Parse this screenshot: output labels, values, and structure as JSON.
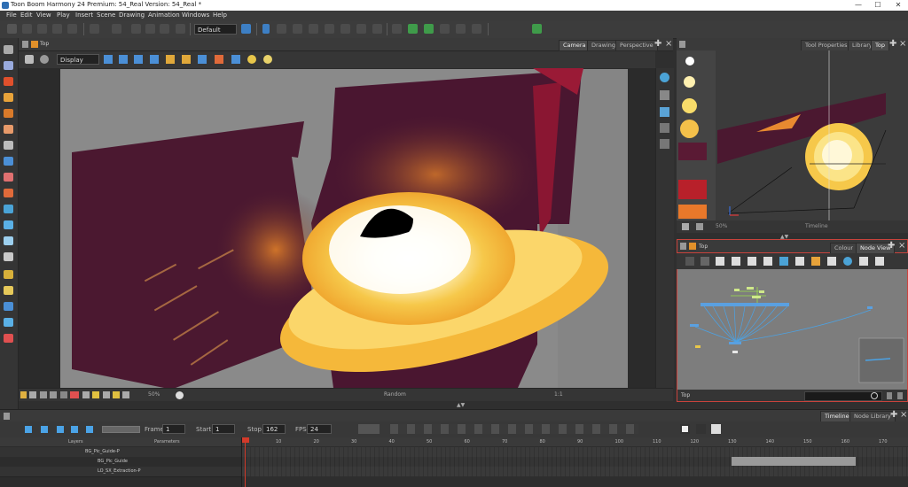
{
  "window": {
    "title": "Toon Boom Harmony 24 Premium: 54_Real Version: 54_Real *",
    "controls": [
      "—",
      "☐",
      "✕"
    ]
  },
  "menu": [
    "File",
    "Edit",
    "View",
    "Play",
    "Insert",
    "Scene",
    "Drawing",
    "Animation",
    "Windows",
    "Help"
  ],
  "toolbar": {
    "workspace": "Default"
  },
  "camera_panel": {
    "breadcrumb": "Top",
    "tabs": [
      "Camera",
      "Drawing",
      "Perspective"
    ],
    "display_select": "Display",
    "bottom_zoom": "50%",
    "bottom_renderer": "Random",
    "bottom_mode": "1:1"
  },
  "top_panel": {
    "tabs": [
      "Tool Properties",
      "Library",
      "Top"
    ],
    "bottom_left": "50%",
    "bottom_label": "Timeline"
  },
  "node_panel": {
    "breadcrumb": "Top",
    "tabs": [
      "Colour",
      "Node View"
    ],
    "bottom_path": "Top"
  },
  "timeline": {
    "tabs": [
      "Timeline",
      "Node Library"
    ],
    "frame_label": "Frame",
    "frame_value": "1",
    "start_label": "Start",
    "start_value": "1",
    "stop_label": "Stop",
    "stop_value": "162",
    "fps_label": "FPS",
    "fps_value": "24",
    "layers_header": "Layers",
    "parameters_header": "Parameters",
    "layers": [
      {
        "name": "BG_Pic_Guide-P"
      },
      {
        "name": "BG_Pic_Guide"
      },
      {
        "name": "LO_SX_Extraction-P"
      }
    ],
    "ruler": [
      "10",
      "20",
      "30",
      "40",
      "50",
      "60",
      "70",
      "80",
      "90",
      "100",
      "110",
      "120",
      "130",
      "140",
      "150",
      "160",
      "170"
    ]
  },
  "colors": {
    "accent_blue": "#3d7fc4",
    "node_view_border": "#c8433c",
    "playhead": "#d23a2a"
  }
}
